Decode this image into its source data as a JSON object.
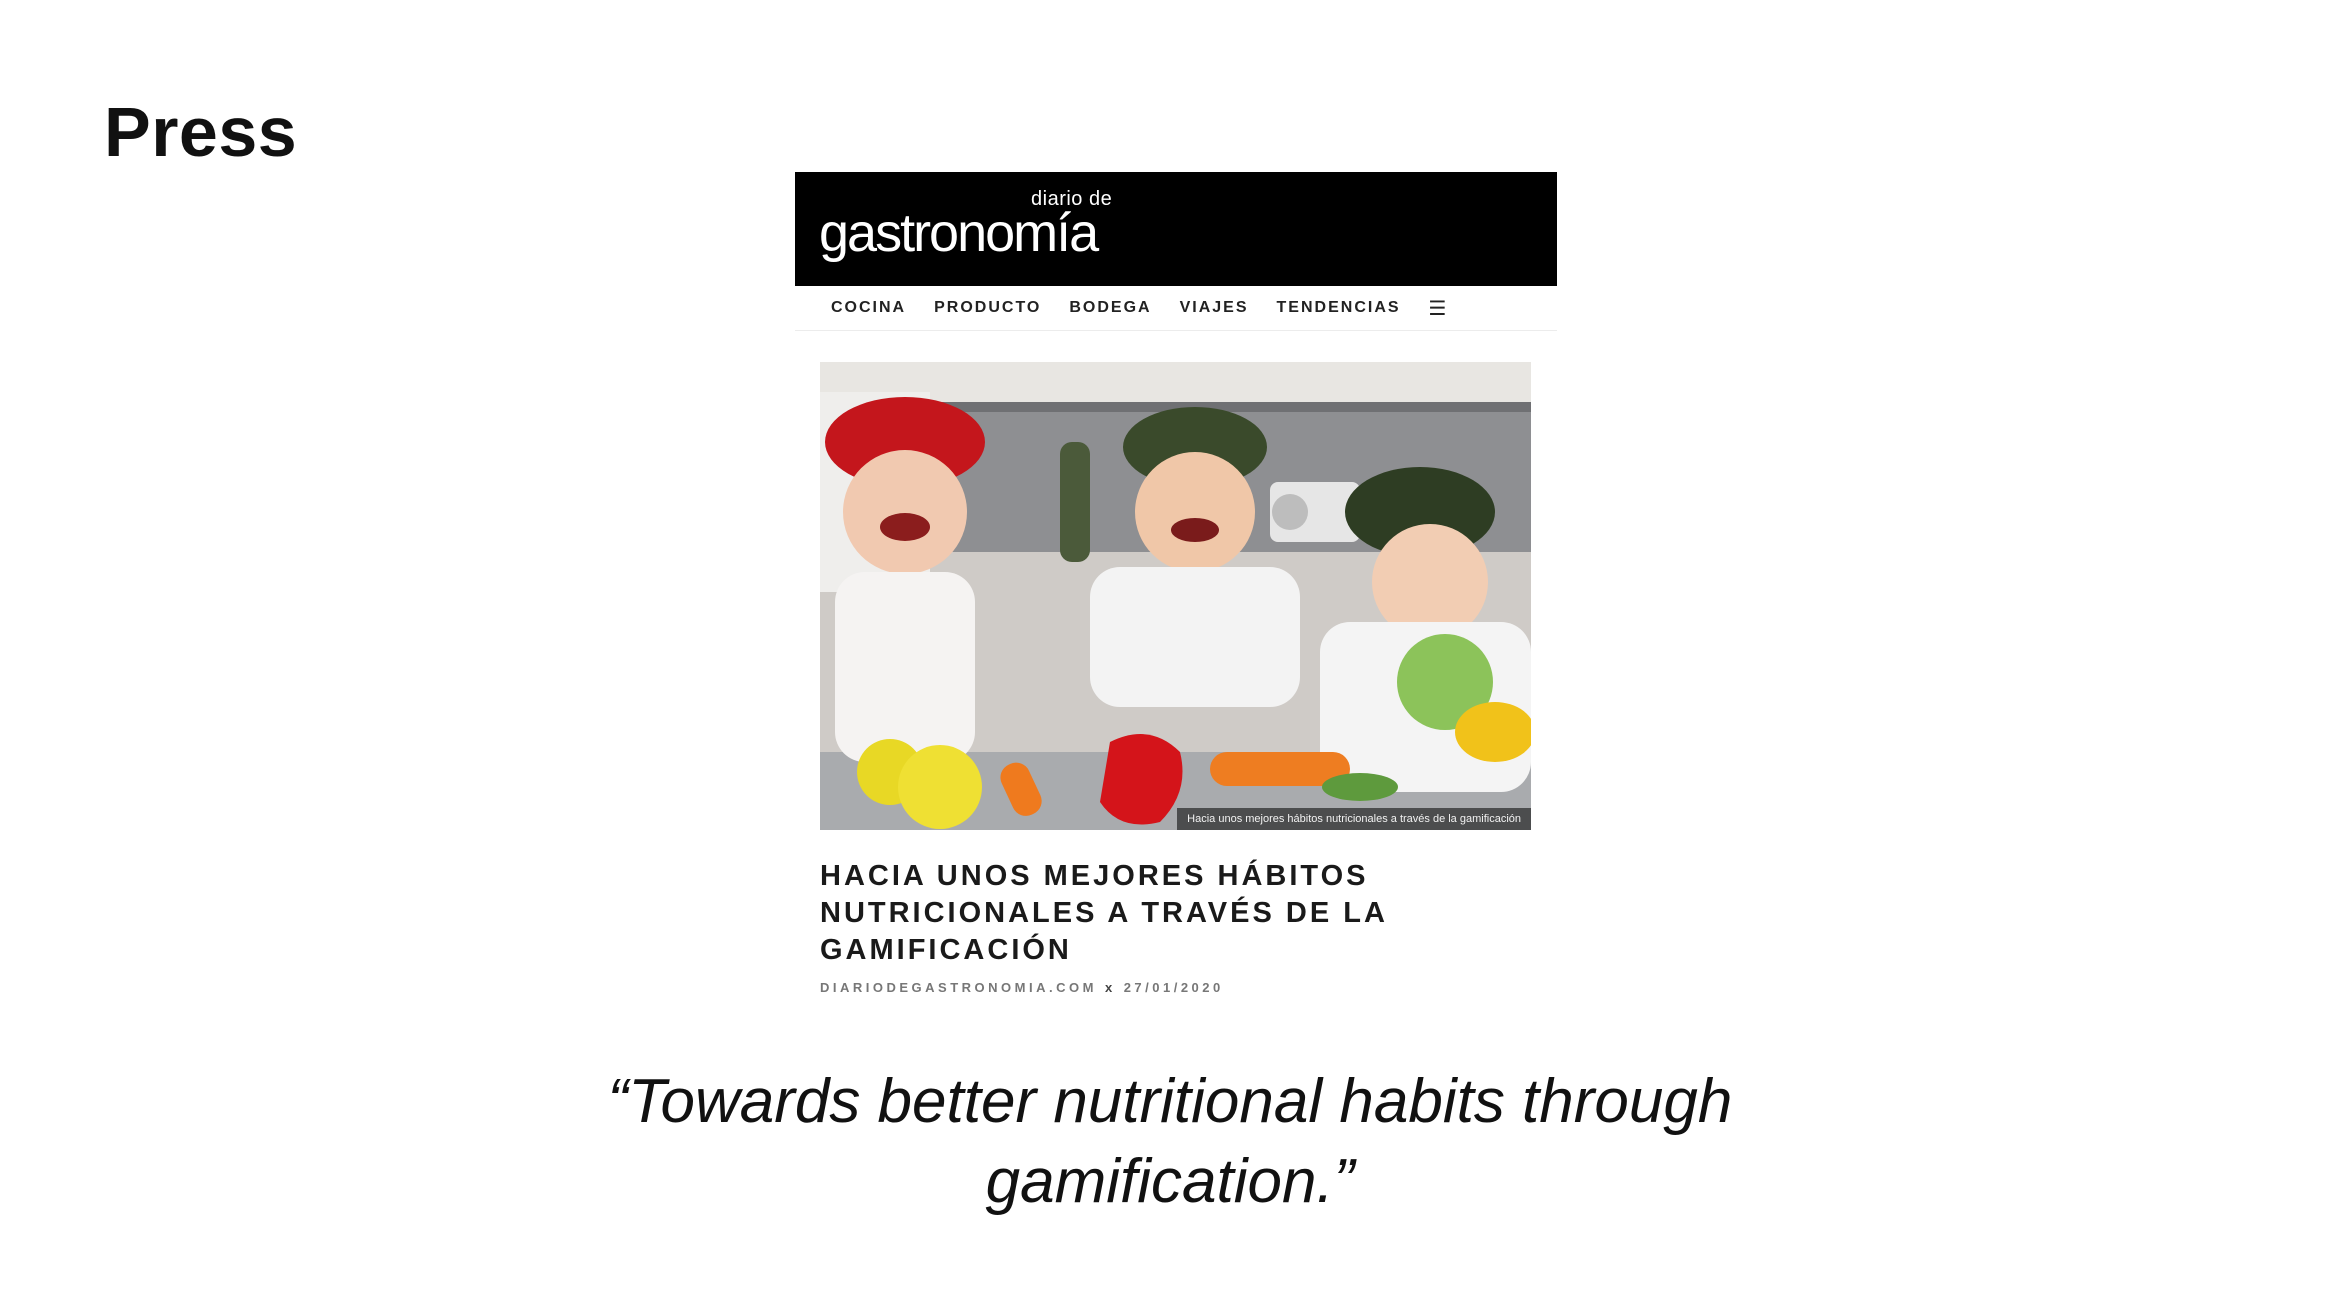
{
  "slide": {
    "title": "Press"
  },
  "publication": {
    "logo_small": "diario de",
    "logo_main": "gastronomía",
    "nav": [
      "COCINA",
      "PRODUCTO",
      "BODEGA",
      "VIAJES",
      "TENDENCIAS"
    ]
  },
  "article": {
    "image_caption": "Hacia unos mejores hábitos nutricionales a través de la gamificación",
    "headline": "HACIA UNOS MEJORES HÁBITOS NUTRICIONALES A TRAVÉS DE LA GAMIFICACIÓN",
    "source": "DIARIODEGASTRONOMIA.COM",
    "separator": "x",
    "date": "27/01/2020"
  },
  "quote": {
    "text": "“Towards better nutritional habits through gamification.”"
  },
  "colors": {
    "masthead_bg": "#000000",
    "text": "#111111",
    "byline": "#777777"
  }
}
